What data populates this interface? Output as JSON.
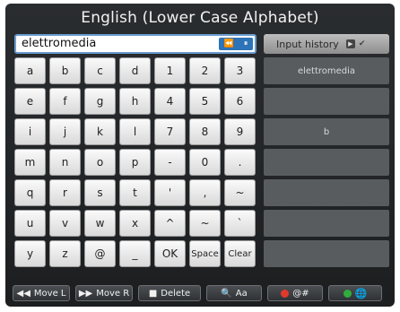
{
  "title": "English (Lower Case Alphabet)",
  "input": {
    "value": "elettromedia",
    "btn_icons": [
      "rewind-icon",
      "pause-icon"
    ]
  },
  "keys": [
    [
      "a",
      "b",
      "c",
      "d",
      "1",
      "2",
      "3"
    ],
    [
      "e",
      "f",
      "g",
      "h",
      "4",
      "5",
      "6"
    ],
    [
      "i",
      "j",
      "k",
      "l",
      "7",
      "8",
      "9"
    ],
    [
      "m",
      "n",
      "o",
      "p",
      "-",
      "0",
      "."
    ],
    [
      "q",
      "r",
      "s",
      "t",
      "'",
      ",",
      "~"
    ],
    [
      "u",
      "v",
      "w",
      "x",
      "^",
      "~",
      "`"
    ],
    [
      "y",
      "z",
      "@",
      "_",
      "OK",
      "Space",
      "Clear"
    ]
  ],
  "history": {
    "header": "Input history",
    "items": [
      "elettromedia",
      "",
      "b",
      "",
      "",
      "",
      ""
    ]
  },
  "bottom": {
    "move_l": "Move L",
    "move_r": "Move R",
    "delete": "Delete",
    "case": "Aa",
    "symbols": "@#",
    "colors": {
      "red": "#e0392b",
      "green": "#2fae3b"
    }
  }
}
